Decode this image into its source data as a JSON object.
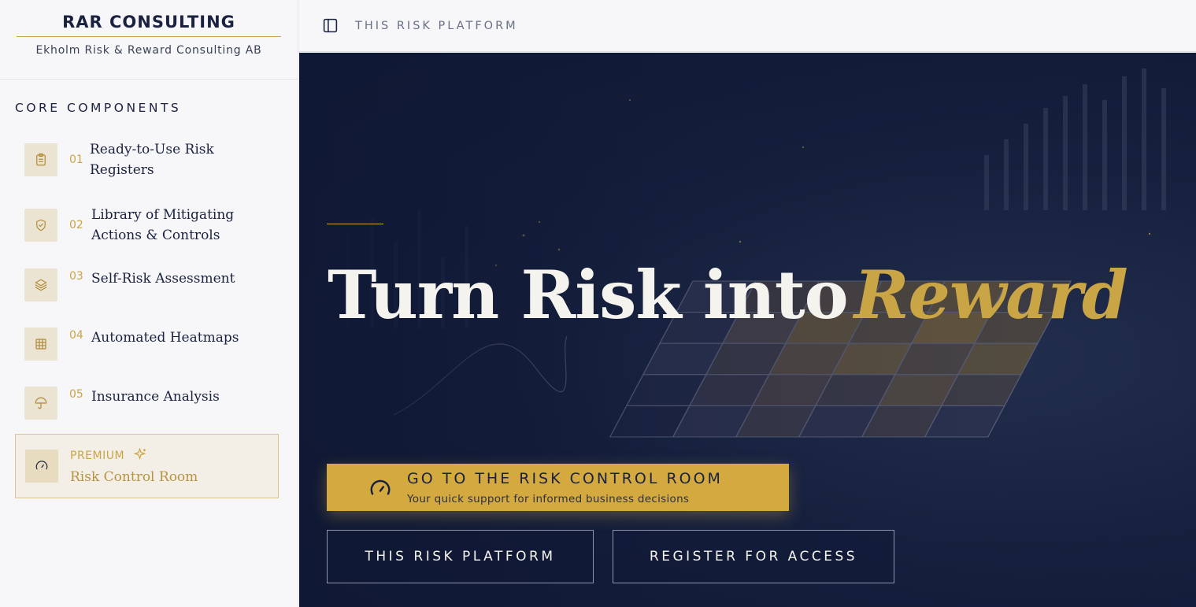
{
  "brand": {
    "title": "RAR CONSULTING",
    "subtitle": "Ekholm Risk & Reward Consulting AB"
  },
  "sidebar": {
    "section_title": "CORE COMPONENTS",
    "items": [
      {
        "num": "01",
        "label_line1": "Ready-to-Use Risk",
        "label_line2": "Registers",
        "icon": "clipboard-list-icon"
      },
      {
        "num": "02",
        "label_line1": "Library of Mitigating",
        "label_line2": "Actions & Controls",
        "icon": "shield-check-icon"
      },
      {
        "num": "03",
        "label_line1": "Self-Risk Assessment",
        "label_line2": "",
        "icon": "layers-icon"
      },
      {
        "num": "04",
        "label_line1": "Automated Heatmaps",
        "label_line2": "",
        "icon": "grid-icon"
      },
      {
        "num": "05",
        "label_line1": "Insurance Analysis",
        "label_line2": "",
        "icon": "umbrella-icon"
      }
    ],
    "premium": {
      "tag": "PREMIUM",
      "label": "Risk Control Room",
      "icon": "gauge-icon",
      "tag_icon": "sparkles-icon"
    }
  },
  "topbar": {
    "title": "THIS RISK PLATFORM",
    "toggle_icon": "sidebar-toggle-icon"
  },
  "hero": {
    "headline_main": "Turn Risk into",
    "headline_accent": "Reward",
    "cta_title": "GO TO THE RISK CONTROL ROOM",
    "cta_subtitle": "Your quick support for informed business decisions",
    "button_platform": "THIS RISK PLATFORM",
    "button_register": "REGISTER FOR ACCESS"
  },
  "colors": {
    "navy": "#1a2240",
    "gold": "#c9a545",
    "cta_gold": "#d3a940",
    "hero_bg": "#16213f"
  }
}
